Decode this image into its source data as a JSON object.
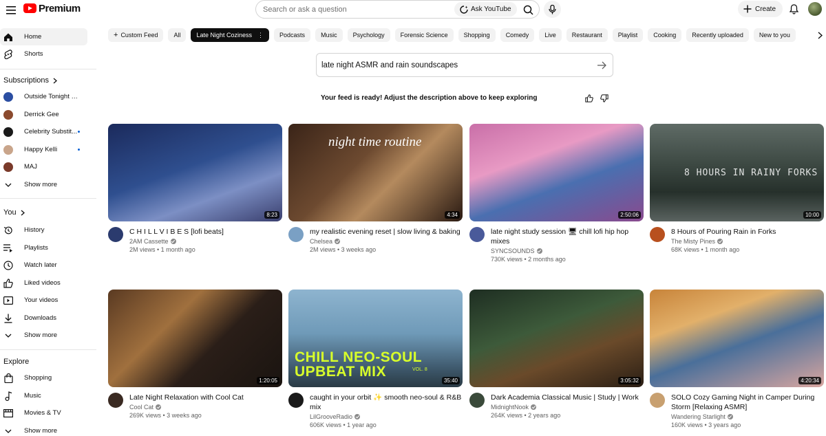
{
  "header": {
    "logo_text": "Premium",
    "search_placeholder": "Search or ask a question",
    "ask_label": "Ask YouTube",
    "create_label": "Create"
  },
  "sidebar": {
    "main": [
      {
        "label": "Home",
        "icon": "home-icon"
      },
      {
        "label": "Shorts",
        "icon": "shorts-icon"
      }
    ],
    "subscriptions_heading": "Subscriptions",
    "subscriptions": [
      {
        "label": "Outside Tonight Wit...",
        "color": "#2b4ea2",
        "new": false
      },
      {
        "label": "Derrick Gee",
        "color": "#8b4a2e",
        "new": false
      },
      {
        "label": "Celebrity Substit...",
        "color": "#1a1a1a",
        "new": true
      },
      {
        "label": "Happy Kelli",
        "color": "#c9a58b",
        "new": true
      },
      {
        "label": "MAJ",
        "color": "#7a3a2a",
        "new": false
      }
    ],
    "subs_show_more": "Show more",
    "you_heading": "You",
    "you_items": [
      {
        "label": "History",
        "icon": "history-icon"
      },
      {
        "label": "Playlists",
        "icon": "playlists-icon"
      },
      {
        "label": "Watch later",
        "icon": "watch-later-icon"
      },
      {
        "label": "Liked videos",
        "icon": "thumbs-up-icon"
      },
      {
        "label": "Your videos",
        "icon": "your-videos-icon"
      },
      {
        "label": "Downloads",
        "icon": "download-icon"
      }
    ],
    "you_show_more": "Show more",
    "explore_heading": "Explore",
    "explore_items": [
      {
        "label": "Shopping",
        "icon": "shopping-bag-icon"
      },
      {
        "label": "Music",
        "icon": "music-note-icon"
      },
      {
        "label": "Movies & TV",
        "icon": "film-icon"
      }
    ],
    "explore_show_more": "Show more"
  },
  "chips": {
    "custom_feed": "Custom Feed",
    "items": [
      "All",
      "Late Night Coziness",
      "Podcasts",
      "Music",
      "Psychology",
      "Forensic Science",
      "Shopping",
      "Comedy",
      "Live",
      "Restaurant",
      "Playlist",
      "Cooking",
      "Recently uploaded",
      "New to you"
    ],
    "active_index": 1
  },
  "prompt": {
    "text": "late night ASMR and rain soundscapes",
    "feed_ready": "Your feed is ready! Adjust the description above to keep exploring"
  },
  "videos": [
    {
      "title": "C H I L L  V I B E S [lofi beats]",
      "channel": "2AM Cassette",
      "verified": true,
      "stats": "2M views • 1 month ago",
      "duration": "8:23",
      "thumb_gradient": "linear-gradient(160deg,#1b2a5c 0%,#2f4f8f 45%,#7c8fc4 70%,#3a3f6e 100%)",
      "avatar_color": "#2b3b6e"
    },
    {
      "title": "my realistic evening reset | slow living & baking",
      "channel": "Chelsea",
      "verified": true,
      "stats": "2M views • 3 weeks ago",
      "duration": "4:34",
      "thumb_gradient": "linear-gradient(135deg,#3a2418 0%,#6d4a30 40%,#b48a5e 60%,#2a1a12 100%)",
      "thumb_title": "night time routine",
      "avatar_color": "#7aa0c4"
    },
    {
      "title": "late night study session 🖥 chill lofi hip hop mixes",
      "channel": "SYNCSOUNDS",
      "verified": true,
      "stats": "730K views • 2 months ago",
      "duration": "2:50:06",
      "thumb_gradient": "linear-gradient(160deg,#c96fa8 0%,#e89ac4 35%,#4a6fb0 60%,#8a4a8e 100%)",
      "avatar_color": "#4a5a9a"
    },
    {
      "title": "8 Hours of Pouring Rain in Forks",
      "channel": "The Misty Pines",
      "verified": true,
      "stats": "68K views • 1 month ago",
      "duration": "10:00",
      "thumb_gradient": "linear-gradient(180deg,#5f6b66 0%,#3e4a44 40%,#26302b 70%,#5a6360 100%)",
      "thumb_title": "8 HOURS IN RAINY FORKS",
      "avatar_color": "#b8501e"
    },
    {
      "title": "Late Night Relaxation with Cool Cat",
      "channel": "Cool Cat",
      "verified": true,
      "stats": "269K views • 3 weeks ago",
      "duration": "1:20:05",
      "thumb_gradient": "linear-gradient(135deg,#5a3a22 0%,#a0703e 35%,#2a1e18 60%,#1a1410 100%)",
      "avatar_color": "#3a2a22"
    },
    {
      "title": "caught in your orbit ✨ smooth neo-soul & R&B mix",
      "channel": "LilGrooveRadio",
      "verified": true,
      "stats": "606K views • 1 year ago",
      "duration": "35:40",
      "thumb_gradient": "linear-gradient(180deg,#8eb4cf 0%,#6f9ab8 45%,#3f5a6e 80%,#2a3a44 100%)",
      "thumb_title": "CHILL NEO-SOUL UPBEAT MIX",
      "thumb_subtitle": "VOL. 8",
      "avatar_color": "#1a1a1a"
    },
    {
      "title": "Dark Academia Classical Music | Study | Work",
      "channel": "MidnightNook",
      "verified": true,
      "stats": "264K views • 2 years ago",
      "duration": "3:05:32",
      "thumb_gradient": "linear-gradient(160deg,#1e2e22 0%,#3d5a3a 40%,#6a4a2a 65%,#2a1e14 100%)",
      "avatar_color": "#3a4a3a"
    },
    {
      "title": "SOLO Cozy Gaming Night in Camper During Storm [Relaxing ASMR]",
      "channel": "Wandering Starlight",
      "verified": true,
      "stats": "160K views • 3 years ago",
      "duration": "4:20:34",
      "thumb_gradient": "linear-gradient(160deg,#c8843a 0%,#e2b06a 30%,#4a6f9a 55%,#d8a6a0 100%)",
      "avatar_color": "#c8a070"
    }
  ]
}
